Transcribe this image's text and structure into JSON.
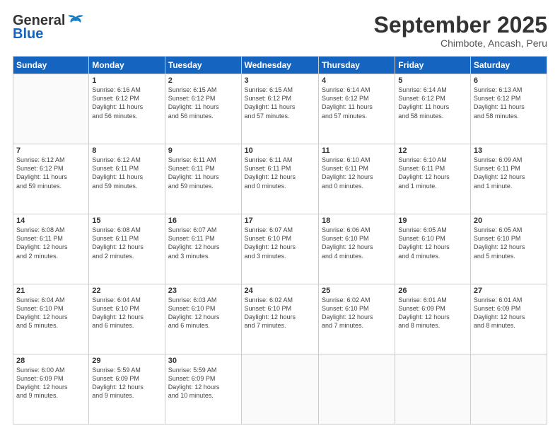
{
  "header": {
    "logo_general": "General",
    "logo_blue": "Blue",
    "month": "September 2025",
    "location": "Chimbote, Ancash, Peru"
  },
  "weekdays": [
    "Sunday",
    "Monday",
    "Tuesday",
    "Wednesday",
    "Thursday",
    "Friday",
    "Saturday"
  ],
  "weeks": [
    [
      {
        "day": "",
        "info": ""
      },
      {
        "day": "1",
        "info": "Sunrise: 6:16 AM\nSunset: 6:12 PM\nDaylight: 11 hours\nand 56 minutes."
      },
      {
        "day": "2",
        "info": "Sunrise: 6:15 AM\nSunset: 6:12 PM\nDaylight: 11 hours\nand 56 minutes."
      },
      {
        "day": "3",
        "info": "Sunrise: 6:15 AM\nSunset: 6:12 PM\nDaylight: 11 hours\nand 57 minutes."
      },
      {
        "day": "4",
        "info": "Sunrise: 6:14 AM\nSunset: 6:12 PM\nDaylight: 11 hours\nand 57 minutes."
      },
      {
        "day": "5",
        "info": "Sunrise: 6:14 AM\nSunset: 6:12 PM\nDaylight: 11 hours\nand 58 minutes."
      },
      {
        "day": "6",
        "info": "Sunrise: 6:13 AM\nSunset: 6:12 PM\nDaylight: 11 hours\nand 58 minutes."
      }
    ],
    [
      {
        "day": "7",
        "info": "Sunrise: 6:12 AM\nSunset: 6:12 PM\nDaylight: 11 hours\nand 59 minutes."
      },
      {
        "day": "8",
        "info": "Sunrise: 6:12 AM\nSunset: 6:11 PM\nDaylight: 11 hours\nand 59 minutes."
      },
      {
        "day": "9",
        "info": "Sunrise: 6:11 AM\nSunset: 6:11 PM\nDaylight: 11 hours\nand 59 minutes."
      },
      {
        "day": "10",
        "info": "Sunrise: 6:11 AM\nSunset: 6:11 PM\nDaylight: 12 hours\nand 0 minutes."
      },
      {
        "day": "11",
        "info": "Sunrise: 6:10 AM\nSunset: 6:11 PM\nDaylight: 12 hours\nand 0 minutes."
      },
      {
        "day": "12",
        "info": "Sunrise: 6:10 AM\nSunset: 6:11 PM\nDaylight: 12 hours\nand 1 minute."
      },
      {
        "day": "13",
        "info": "Sunrise: 6:09 AM\nSunset: 6:11 PM\nDaylight: 12 hours\nand 1 minute."
      }
    ],
    [
      {
        "day": "14",
        "info": "Sunrise: 6:08 AM\nSunset: 6:11 PM\nDaylight: 12 hours\nand 2 minutes."
      },
      {
        "day": "15",
        "info": "Sunrise: 6:08 AM\nSunset: 6:11 PM\nDaylight: 12 hours\nand 2 minutes."
      },
      {
        "day": "16",
        "info": "Sunrise: 6:07 AM\nSunset: 6:11 PM\nDaylight: 12 hours\nand 3 minutes."
      },
      {
        "day": "17",
        "info": "Sunrise: 6:07 AM\nSunset: 6:10 PM\nDaylight: 12 hours\nand 3 minutes."
      },
      {
        "day": "18",
        "info": "Sunrise: 6:06 AM\nSunset: 6:10 PM\nDaylight: 12 hours\nand 4 minutes."
      },
      {
        "day": "19",
        "info": "Sunrise: 6:05 AM\nSunset: 6:10 PM\nDaylight: 12 hours\nand 4 minutes."
      },
      {
        "day": "20",
        "info": "Sunrise: 6:05 AM\nSunset: 6:10 PM\nDaylight: 12 hours\nand 5 minutes."
      }
    ],
    [
      {
        "day": "21",
        "info": "Sunrise: 6:04 AM\nSunset: 6:10 PM\nDaylight: 12 hours\nand 5 minutes."
      },
      {
        "day": "22",
        "info": "Sunrise: 6:04 AM\nSunset: 6:10 PM\nDaylight: 12 hours\nand 6 minutes."
      },
      {
        "day": "23",
        "info": "Sunrise: 6:03 AM\nSunset: 6:10 PM\nDaylight: 12 hours\nand 6 minutes."
      },
      {
        "day": "24",
        "info": "Sunrise: 6:02 AM\nSunset: 6:10 PM\nDaylight: 12 hours\nand 7 minutes."
      },
      {
        "day": "25",
        "info": "Sunrise: 6:02 AM\nSunset: 6:10 PM\nDaylight: 12 hours\nand 7 minutes."
      },
      {
        "day": "26",
        "info": "Sunrise: 6:01 AM\nSunset: 6:09 PM\nDaylight: 12 hours\nand 8 minutes."
      },
      {
        "day": "27",
        "info": "Sunrise: 6:01 AM\nSunset: 6:09 PM\nDaylight: 12 hours\nand 8 minutes."
      }
    ],
    [
      {
        "day": "28",
        "info": "Sunrise: 6:00 AM\nSunset: 6:09 PM\nDaylight: 12 hours\nand 9 minutes."
      },
      {
        "day": "29",
        "info": "Sunrise: 5:59 AM\nSunset: 6:09 PM\nDaylight: 12 hours\nand 9 minutes."
      },
      {
        "day": "30",
        "info": "Sunrise: 5:59 AM\nSunset: 6:09 PM\nDaylight: 12 hours\nand 10 minutes."
      },
      {
        "day": "",
        "info": ""
      },
      {
        "day": "",
        "info": ""
      },
      {
        "day": "",
        "info": ""
      },
      {
        "day": "",
        "info": ""
      }
    ]
  ]
}
